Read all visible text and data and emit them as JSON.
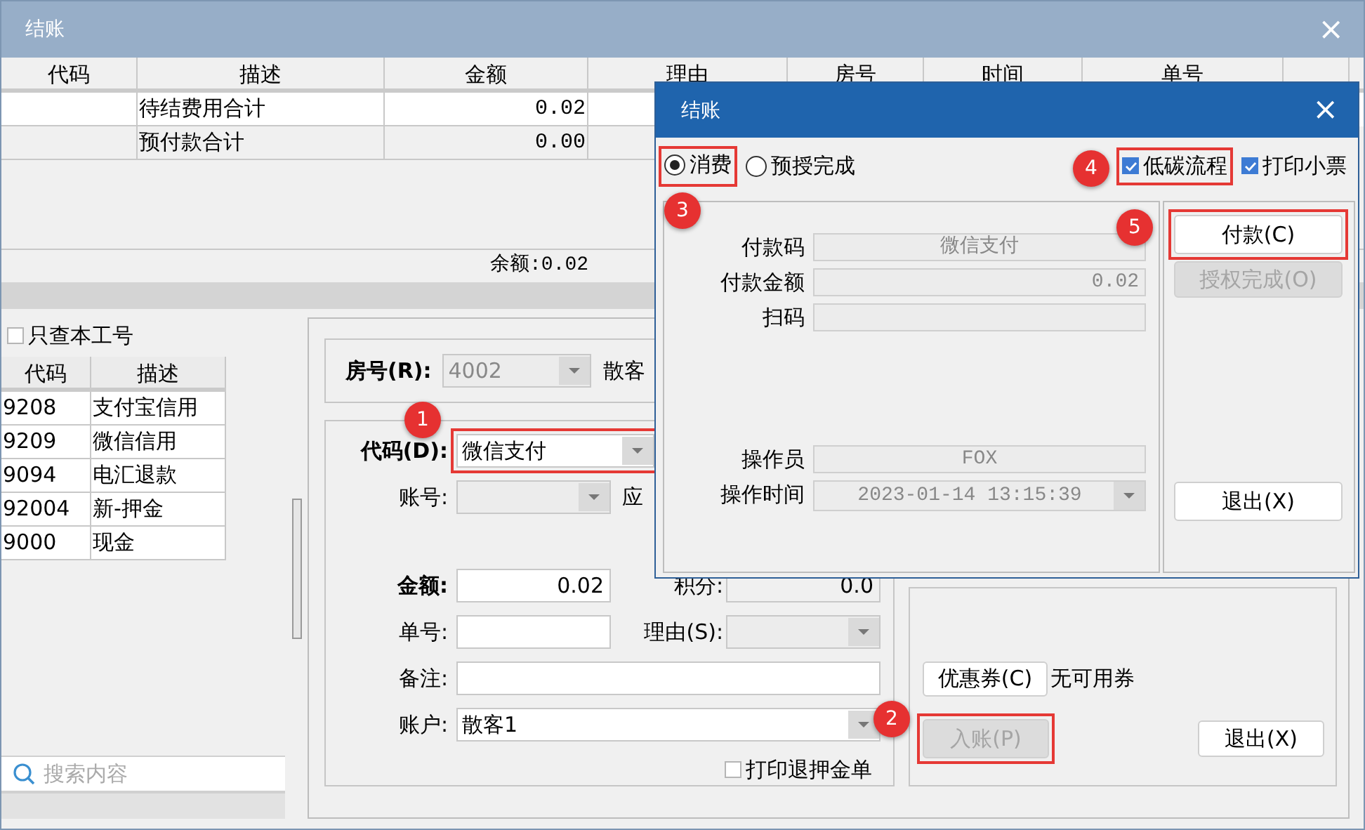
{
  "window": {
    "title": "结账",
    "close": "×"
  },
  "table": {
    "columns": [
      "代码",
      "描述",
      "金额",
      "理由",
      "房号",
      "时间",
      "单号"
    ],
    "rows": [
      {
        "description": "待结费用合计",
        "amount": "0.02"
      },
      {
        "description": "预付款合计",
        "amount": "0.00"
      }
    ],
    "balance": "余额:0.02"
  },
  "left_panel": {
    "only_mine": {
      "label": "只查本工号",
      "checked": false
    },
    "columns": [
      "代码",
      "描述"
    ],
    "rows": [
      {
        "code": "9208",
        "description": "支付宝信用"
      },
      {
        "code": "9209",
        "description": "微信信用"
      },
      {
        "code": "9094",
        "description": "电汇退款"
      },
      {
        "code": "92004",
        "description": "新-押金"
      },
      {
        "code": "9000",
        "description": "现金"
      }
    ],
    "search": {
      "placeholder": "搜索内容"
    }
  },
  "room": {
    "label": "房号(R):",
    "value": "4002",
    "disabled": true,
    "guest": "散客"
  },
  "form": {
    "code": {
      "label": "代码(D):",
      "value": "微信支付",
      "highlighted": true,
      "badge": "1"
    },
    "account_no": {
      "label": "账号:"
    },
    "receivable": {
      "label": "应"
    },
    "amount": {
      "label": "金额:",
      "value": "0.02"
    },
    "points": {
      "label": "积分:",
      "value": "0.0"
    },
    "bill_no": {
      "label": "单号:"
    },
    "reason": {
      "label": "理由(S):"
    },
    "note": {
      "label": "备注:"
    },
    "account": {
      "label": "账户:",
      "value": "散客1"
    },
    "print_deposit": {
      "label": "打印退押金单",
      "checked": false
    }
  },
  "actions": {
    "coupon": {
      "label": "优惠券(C)",
      "status": "无可用券"
    },
    "post": {
      "label": "入账(P)",
      "disabled": true,
      "highlighted": true,
      "badge": "2"
    },
    "exit": {
      "label": "退出(X)"
    }
  },
  "dialog": {
    "title": "结账",
    "close": "×",
    "modes": [
      {
        "label": "消费",
        "selected": true,
        "highlighted": true,
        "badge": "3"
      },
      {
        "label": "预授完成",
        "selected": false
      }
    ],
    "options": [
      {
        "label": "低碳流程",
        "checked": true,
        "highlighted": true,
        "badge": "4"
      },
      {
        "label": "打印小票",
        "checked": true
      }
    ],
    "fields": [
      {
        "kind": "text",
        "label": "付款码",
        "value": "微信支付",
        "disabled": true
      },
      {
        "kind": "number",
        "label": "付款金额",
        "value": "0.02",
        "disabled": true
      },
      {
        "kind": "text",
        "label": "扫码",
        "disabled": true
      }
    ],
    "operator_fields": [
      {
        "kind": "text",
        "label": "操作员",
        "value": "FOX",
        "disabled": true
      },
      {
        "kind": "select",
        "label": "操作时间",
        "value": "2023-01-14 13:15:39",
        "disabled": true
      }
    ],
    "buttons": [
      {
        "label": "付款(C)",
        "disabled": false,
        "highlighted": true,
        "badge": "5"
      },
      {
        "label": "授权完成(O)",
        "disabled": true
      }
    ],
    "exit": {
      "label": "退出(X)"
    }
  }
}
